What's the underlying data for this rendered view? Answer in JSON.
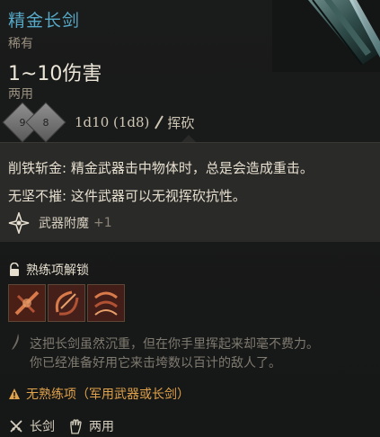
{
  "item": {
    "name": "精金长剑",
    "rarity": "稀有",
    "damage": "1~10伤害",
    "handedness": "两用"
  },
  "dice": {
    "die1_face": "9",
    "die2_face": "8",
    "formula": "1d10 (1d8)",
    "damage_type": "挥砍"
  },
  "passives": [
    "削铁斩金: 精金武器击中物体时，总是会造成重击。",
    "无坚不摧: 这件武器可以无视挥砍抗性。"
  ],
  "enchant": {
    "label": "武器附魔",
    "bonus": "+1"
  },
  "proficiency": {
    "title": "熟练项解锁",
    "icons": [
      "slash-skill-icon",
      "bow-skill-icon",
      "flourish-skill-icon"
    ]
  },
  "flavor": {
    "line1": "这把长剑虽然沉重，但在你手里挥起来却毫不费力。",
    "line2": "你已经准备好用它来击垮数以百计的敌人了。"
  },
  "warning": "无熟练项（军用武器或长剑）",
  "footer": {
    "weapon_type": "长剑",
    "hand_type": "两用"
  },
  "colors": {
    "title": "#56a9c7",
    "warning": "#e0a24a",
    "panel": "#2a2a29"
  }
}
